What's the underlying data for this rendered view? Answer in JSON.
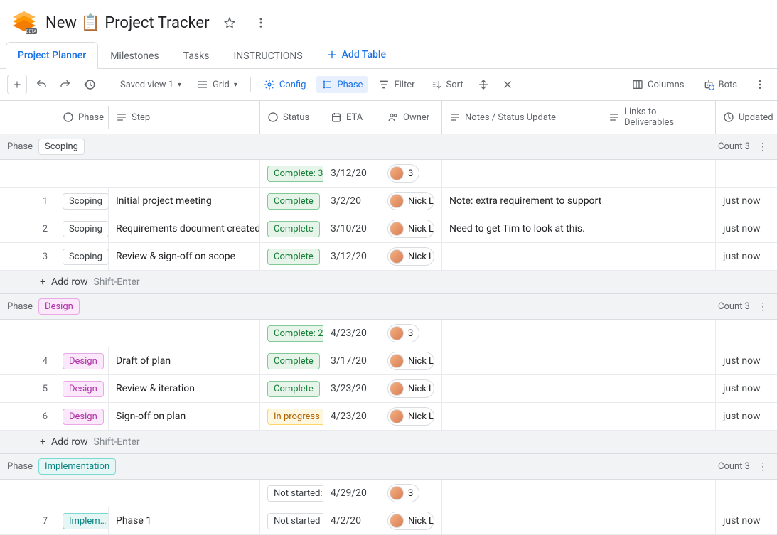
{
  "doc": {
    "title_prefix": "New",
    "title_main": "Project Tracker",
    "emoji": "📋"
  },
  "tabs": {
    "items": [
      "Project Planner",
      "Milestones",
      "Tasks",
      "INSTRUCTIONS"
    ],
    "add_label": "Add Table"
  },
  "toolbar": {
    "saved_view": "Saved view 1",
    "grid": "Grid",
    "config": "Config",
    "phase": "Phase",
    "filter": "Filter",
    "sort": "Sort",
    "columns": "Columns",
    "bots": "Bots"
  },
  "columns": {
    "phase": "Phase",
    "step": "Step",
    "status": "Status",
    "eta": "ETA",
    "owner": "Owner",
    "notes": "Notes / Status Update",
    "links": "Links to Deliverables",
    "updated": "Updated"
  },
  "groups": [
    {
      "phase_label": "Phase",
      "phase_name": "Scoping",
      "phase_class": "scoping",
      "count_label": "Count 3",
      "summary": {
        "status": "Complete: 3",
        "status_class": "status-complete",
        "eta": "3/12/20",
        "owner_count": "3"
      },
      "rows": [
        {
          "n": "1",
          "phase": "Scoping",
          "phase_class": "scoping",
          "step": "Initial project meeting",
          "status": "Complete",
          "status_class": "status-complete",
          "eta": "3/2/20",
          "owner": "Nick La…",
          "notes": "Note: extra requirement to support…",
          "updated": "just now"
        },
        {
          "n": "2",
          "phase": "Scoping",
          "phase_class": "scoping",
          "step": "Requirements document created",
          "status": "Complete",
          "status_class": "status-complete",
          "eta": "3/10/20",
          "owner": "Nick La…",
          "notes": "Need to get Tim to look at this.",
          "updated": "just now"
        },
        {
          "n": "3",
          "phase": "Scoping",
          "phase_class": "scoping",
          "step": "Review & sign-off on scope",
          "status": "Complete",
          "status_class": "status-complete",
          "eta": "3/12/20",
          "owner": "Nick La…",
          "notes": "",
          "updated": "just now"
        }
      ],
      "add_row": "Add row",
      "add_hint": "Shift-Enter"
    },
    {
      "phase_label": "Phase",
      "phase_name": "Design",
      "phase_class": "design",
      "count_label": "Count 3",
      "summary": {
        "status": "Complete: 2",
        "status_class": "status-complete",
        "eta": "4/23/20",
        "owner_count": "3"
      },
      "rows": [
        {
          "n": "4",
          "phase": "Design",
          "phase_class": "design",
          "step": "Draft of plan",
          "status": "Complete",
          "status_class": "status-complete",
          "eta": "3/17/20",
          "owner": "Nick La…",
          "notes": "",
          "updated": "just now"
        },
        {
          "n": "5",
          "phase": "Design",
          "phase_class": "design",
          "step": "Review & iteration",
          "status": "Complete",
          "status_class": "status-complete",
          "eta": "3/23/20",
          "owner": "Nick La…",
          "notes": "",
          "updated": "just now"
        },
        {
          "n": "6",
          "phase": "Design",
          "phase_class": "design",
          "step": "Sign-off on plan",
          "status": "In progress",
          "status_class": "status-inprog",
          "eta": "4/23/20",
          "owner": "Nick La…",
          "notes": "",
          "updated": "just now"
        }
      ],
      "add_row": "Add row",
      "add_hint": "Shift-Enter"
    },
    {
      "phase_label": "Phase",
      "phase_name": "Implementation",
      "phase_class": "impl",
      "count_label": "Count 3",
      "summary": {
        "status": "Not started: ",
        "status_class": "status-notstart",
        "eta": "4/29/20",
        "owner_count": "3"
      },
      "rows": [
        {
          "n": "7",
          "phase": "Implem…",
          "phase_class": "impl",
          "step": "Phase 1",
          "status": "Not started",
          "status_class": "status-notstart",
          "eta": "4/2/20",
          "owner": "Nick La…",
          "notes": "",
          "updated": "just now"
        }
      ]
    }
  ]
}
